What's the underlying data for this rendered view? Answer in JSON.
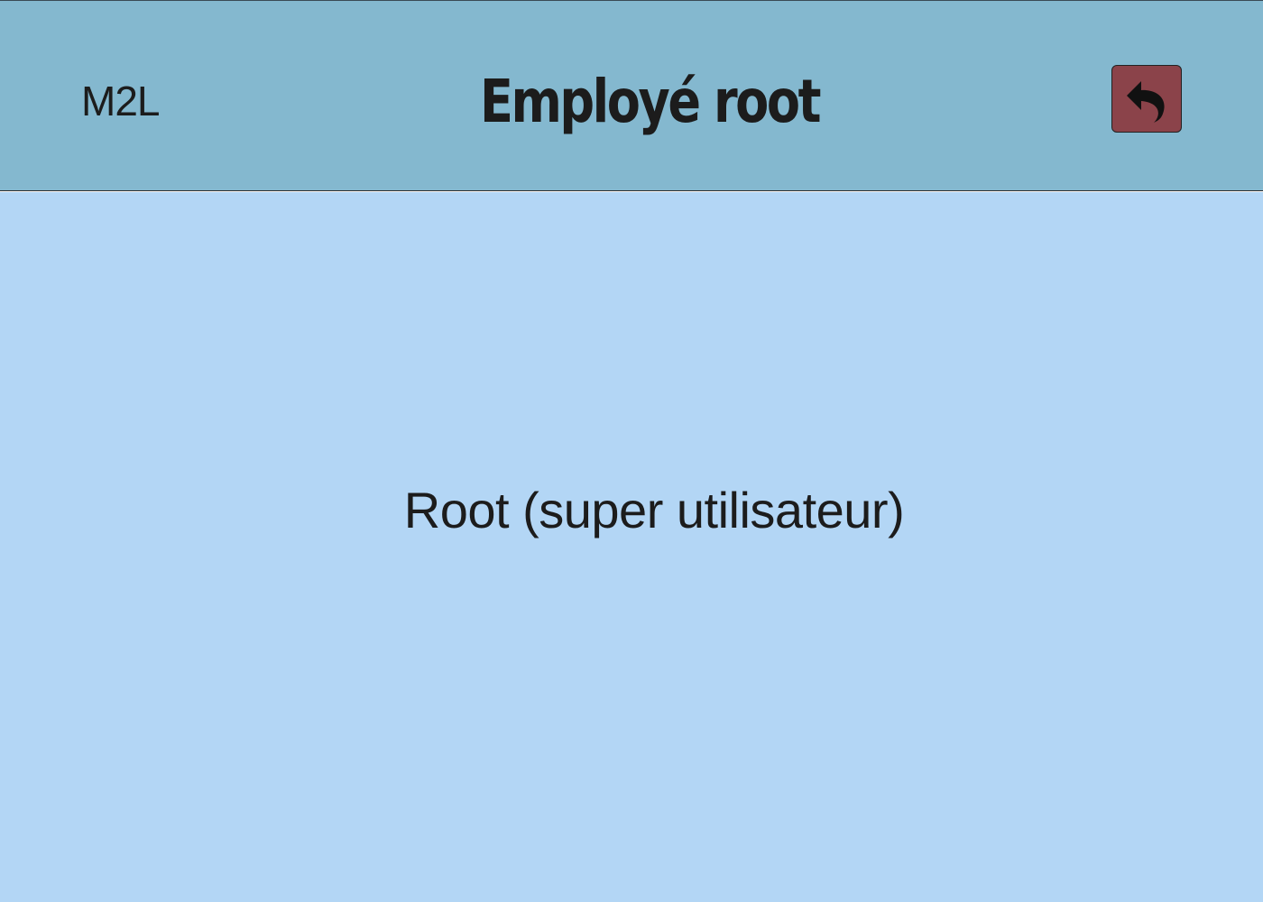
{
  "colors": {
    "header_bg": "#84b8cf",
    "main_bg": "#b3d6f5",
    "back_button_bg": "#8b434a",
    "text": "#1c1c1c"
  },
  "header": {
    "brand": "M2L",
    "title": "Employé root",
    "back_button": {
      "icon": "reply-arrow-icon"
    }
  },
  "main": {
    "role_text": "Root (super utilisateur)"
  }
}
